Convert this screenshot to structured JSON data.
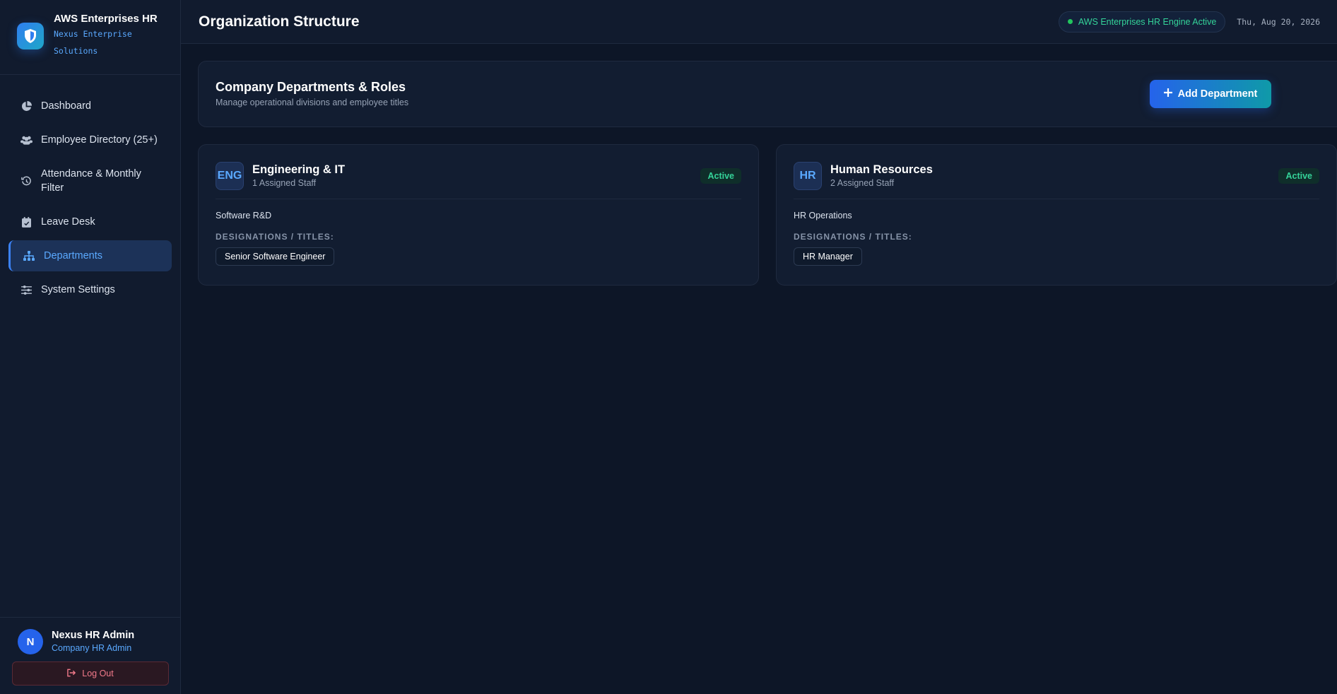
{
  "sidebar": {
    "brand_title": "AWS Enterprises HR",
    "brand_subtitle": "Nexus Enterprise Solutions",
    "items": [
      {
        "label": "Dashboard",
        "icon": "pie-chart-icon"
      },
      {
        "label": "Employee Directory (25+)",
        "icon": "users-icon"
      },
      {
        "label": "Attendance & Monthly Filter",
        "icon": "history-icon"
      },
      {
        "label": "Leave Desk",
        "icon": "calendar-check-icon"
      },
      {
        "label": "Departments",
        "icon": "sitemap-icon",
        "active": true
      },
      {
        "label": "System Settings",
        "icon": "sliders-icon"
      }
    ],
    "user": {
      "initial": "N",
      "name": "Nexus HR Admin",
      "role": "Company HR Admin"
    },
    "logout_label": "Log Out"
  },
  "topbar": {
    "title": "Organization Structure",
    "engine_status": "AWS Enterprises HR Engine Active",
    "date": "Thu, Aug 20, 2026"
  },
  "header_card": {
    "title": "Company Departments & Roles",
    "subtitle": "Manage operational divisions and employee titles",
    "add_button_label": "Add Department"
  },
  "departments": [
    {
      "code": "ENG",
      "name": "Engineering & IT",
      "staff": "1 Assigned Staff",
      "status": "Active",
      "description": "Software R&D",
      "designations_label": "DESIGNATIONS / TITLES:",
      "titles": [
        "Senior Software Engineer"
      ]
    },
    {
      "code": "HR",
      "name": "Human Resources",
      "staff": "2 Assigned Staff",
      "status": "Active",
      "description": "HR Operations",
      "designations_label": "DESIGNATIONS / TITLES:",
      "titles": [
        "HR Manager"
      ]
    }
  ],
  "colors": {
    "background": "#0d1627",
    "accent": "#3b82f6",
    "success": "#34d399",
    "danger": "#f27a8a"
  }
}
